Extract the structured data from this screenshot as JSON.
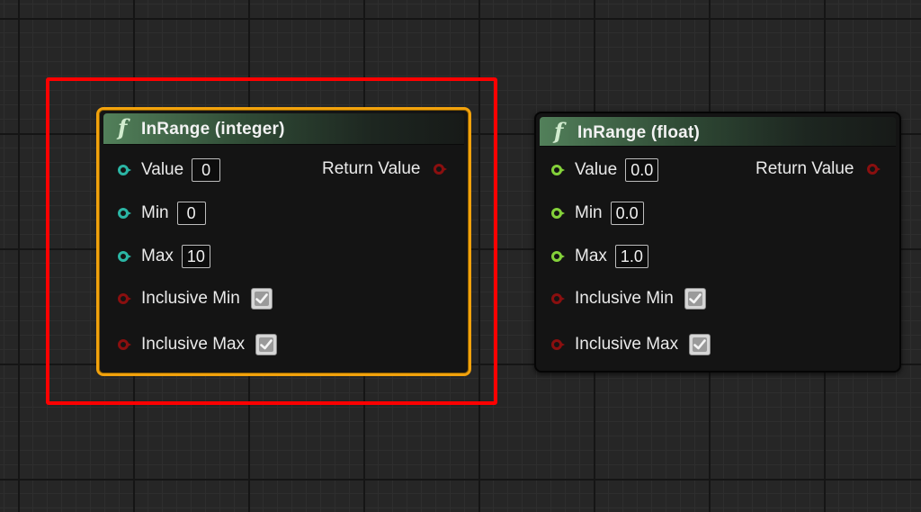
{
  "nodes": [
    {
      "title": "InRange (integer)",
      "icon": "function-icon",
      "selected": true,
      "inputs": {
        "value": {
          "label": "Value",
          "value": "0"
        },
        "min": {
          "label": "Min",
          "value": "0"
        },
        "max": {
          "label": "Max",
          "value": "10"
        },
        "inclusive_min": {
          "label": "Inclusive Min",
          "checked": true
        },
        "inclusive_max": {
          "label": "Inclusive Max",
          "checked": true
        }
      },
      "output": {
        "label": "Return Value"
      }
    },
    {
      "title": "InRange (float)",
      "icon": "function-icon",
      "selected": false,
      "inputs": {
        "value": {
          "label": "Value",
          "value": "0.0"
        },
        "min": {
          "label": "Min",
          "value": "0.0"
        },
        "max": {
          "label": "Max",
          "value": "1.0"
        },
        "inclusive_min": {
          "label": "Inclusive Min",
          "checked": true
        },
        "inclusive_max": {
          "label": "Inclusive Max",
          "checked": true
        }
      },
      "output": {
        "label": "Return Value"
      }
    }
  ],
  "colors": {
    "int_pin": "#2bb5a4",
    "float_pin": "#84d13a",
    "bool_pin": "#8a0f0f",
    "selection_outline": "#f2a20c",
    "annotation_box": "#ff0000",
    "header_green": "#52805a"
  }
}
